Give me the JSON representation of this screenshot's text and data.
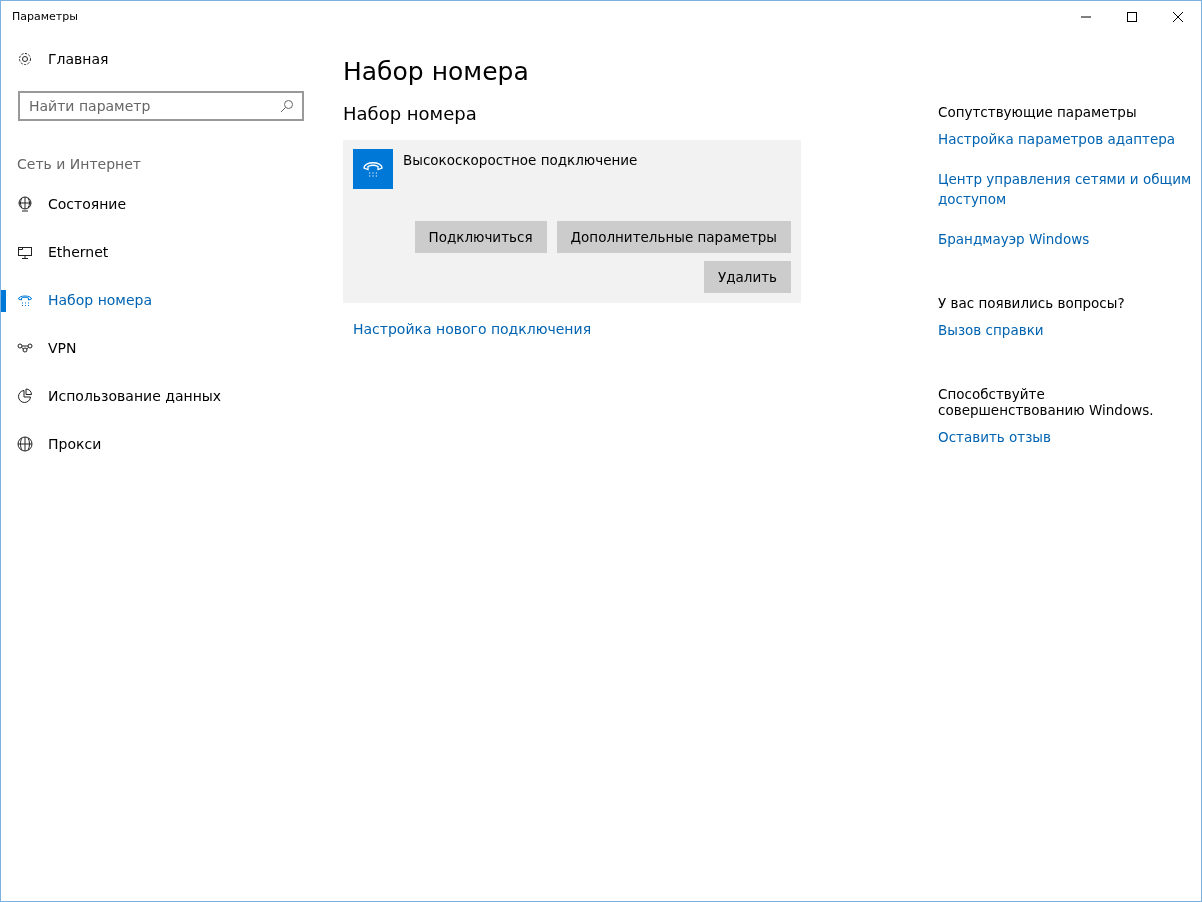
{
  "window": {
    "title": "Параметры"
  },
  "sidebar": {
    "home": "Главная",
    "search": {
      "placeholder": "Найти параметр"
    },
    "section": "Сеть и Интернет",
    "items": [
      {
        "label": "Состояние",
        "selected": false
      },
      {
        "label": "Ethernet",
        "selected": false
      },
      {
        "label": "Набор номера",
        "selected": true
      },
      {
        "label": "VPN",
        "selected": false
      },
      {
        "label": "Использование данных",
        "selected": false
      },
      {
        "label": "Прокси",
        "selected": false
      }
    ]
  },
  "page": {
    "title": "Набор номера",
    "subtitle": "Набор номера",
    "connection": {
      "name": "Высокоскоростное подключение",
      "buttons": [
        "Подключиться",
        "Дополнительные параметры"
      ],
      "delete_button": "Удалить"
    },
    "new_connection_link": "Настройка нового подключения"
  },
  "related": [
    {
      "heading": "Сопутствующие параметры",
      "links": [
        "Настройка параметров адаптера",
        "Центр управления сетями и общим доступом",
        "Брандмауэр Windows"
      ]
    },
    {
      "heading": "У вас появились вопросы?",
      "links": [
        "Вызов справки"
      ]
    },
    {
      "heading": "Способствуйте совершенствованию Windows.",
      "links": [
        "Оставить отзыв"
      ]
    }
  ]
}
